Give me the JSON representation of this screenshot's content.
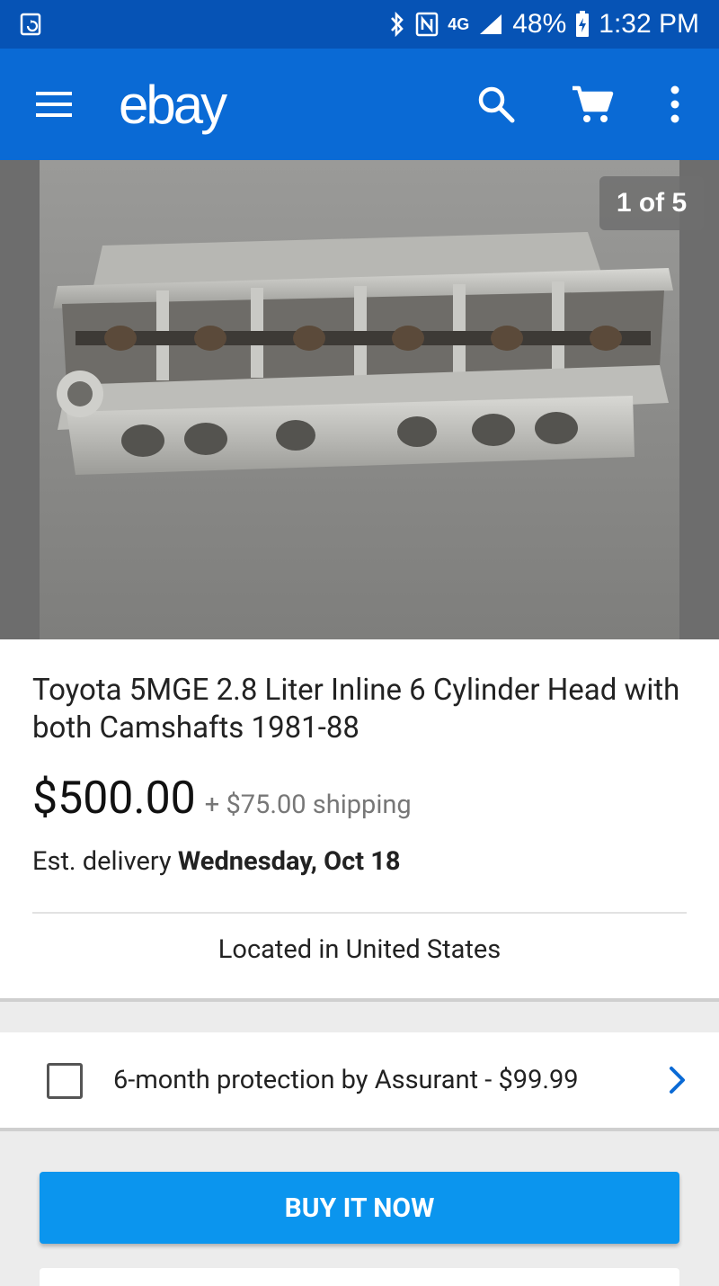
{
  "status_bar": {
    "network": "4G",
    "battery": "48%",
    "time": "1:32 PM"
  },
  "app_bar": {
    "logo": "ebay",
    "icons": [
      "menu-icon",
      "search-icon",
      "cart-icon",
      "more-vert-icon"
    ]
  },
  "carousel": {
    "counter": "1 of 5"
  },
  "item": {
    "title": "Toyota 5MGE 2.8 Liter Inline 6 Cylinder Head with both Camshafts 1981-88",
    "price": "$500.00",
    "shipping": "+ $75.00 shipping",
    "delivery_prefix": "Est. delivery",
    "delivery_date": "Wednesday, Oct 18",
    "location": "Located in United States"
  },
  "protection": {
    "label": "6-month protection by Assurant - $99.99",
    "checked": false
  },
  "actions": {
    "buy_label": "BUY IT NOW"
  },
  "colors": {
    "status_bar": "#0653b5",
    "app_bar": "#0a6ad5",
    "buy_button": "#0b95ee",
    "chevron": "#0a6ad5"
  }
}
